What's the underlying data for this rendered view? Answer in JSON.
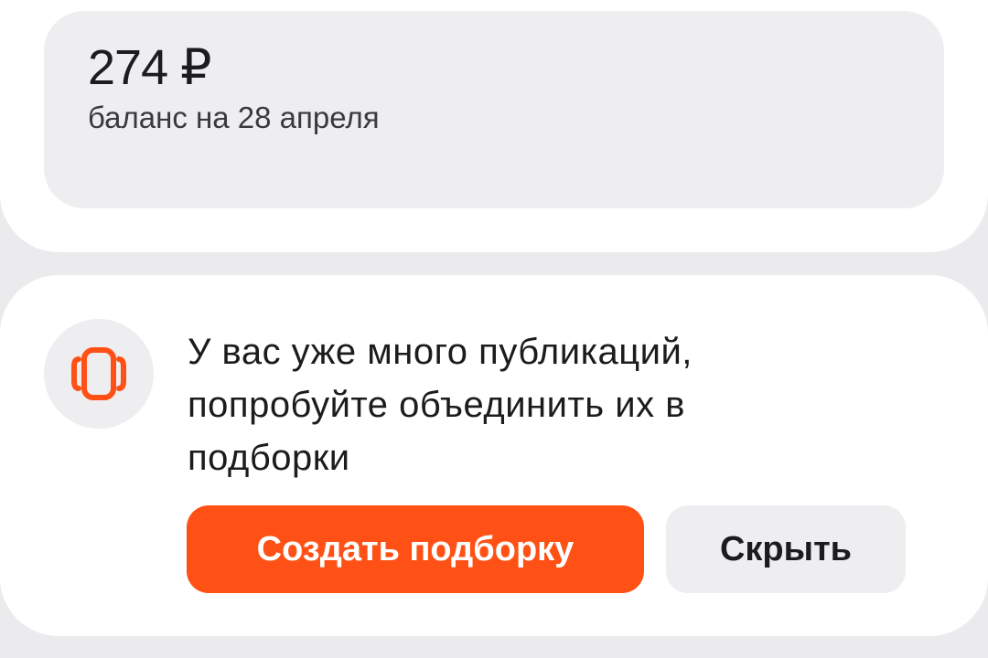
{
  "balance": {
    "amount": "274 ₽",
    "caption": "баланс на 28 апреля"
  },
  "promo": {
    "icon": "collection-icon",
    "text": "У вас уже много публикаций, попробуйте объединить их в подборки",
    "create_label": "Создать подборку",
    "hide_label": "Скрыть"
  },
  "colors": {
    "accent": "#ff5115",
    "card_bg": "#ffffff",
    "page_bg": "#ebebed",
    "muted_bg": "#eeeef0"
  }
}
